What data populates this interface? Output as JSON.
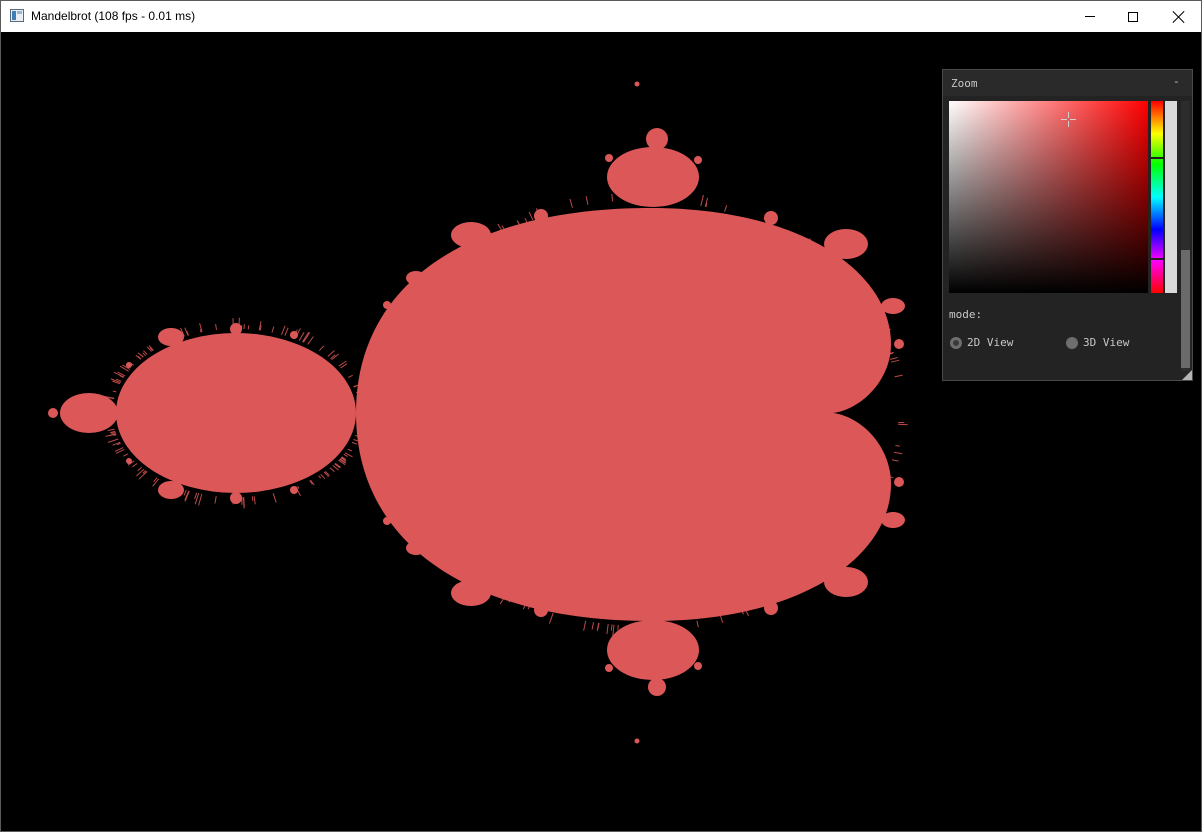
{
  "window": {
    "title": "Mandelbrot (108 fps - 0.01 ms)"
  },
  "icons": {
    "app": "app-window-icon",
    "minimize": "minimize-icon",
    "maximize": "maximize-icon",
    "close": "close-icon"
  },
  "colors": {
    "fractal_fill": "#dc5858",
    "background": "#000000",
    "panel_bg": "#242424",
    "picker_hue": "#ff0000"
  },
  "panel": {
    "title": "Zoom",
    "collapse_label": "-",
    "mode_label": "mode:",
    "options": [
      {
        "label": "2D View",
        "selected": true
      },
      {
        "label": "3D View",
        "selected": false
      }
    ]
  }
}
